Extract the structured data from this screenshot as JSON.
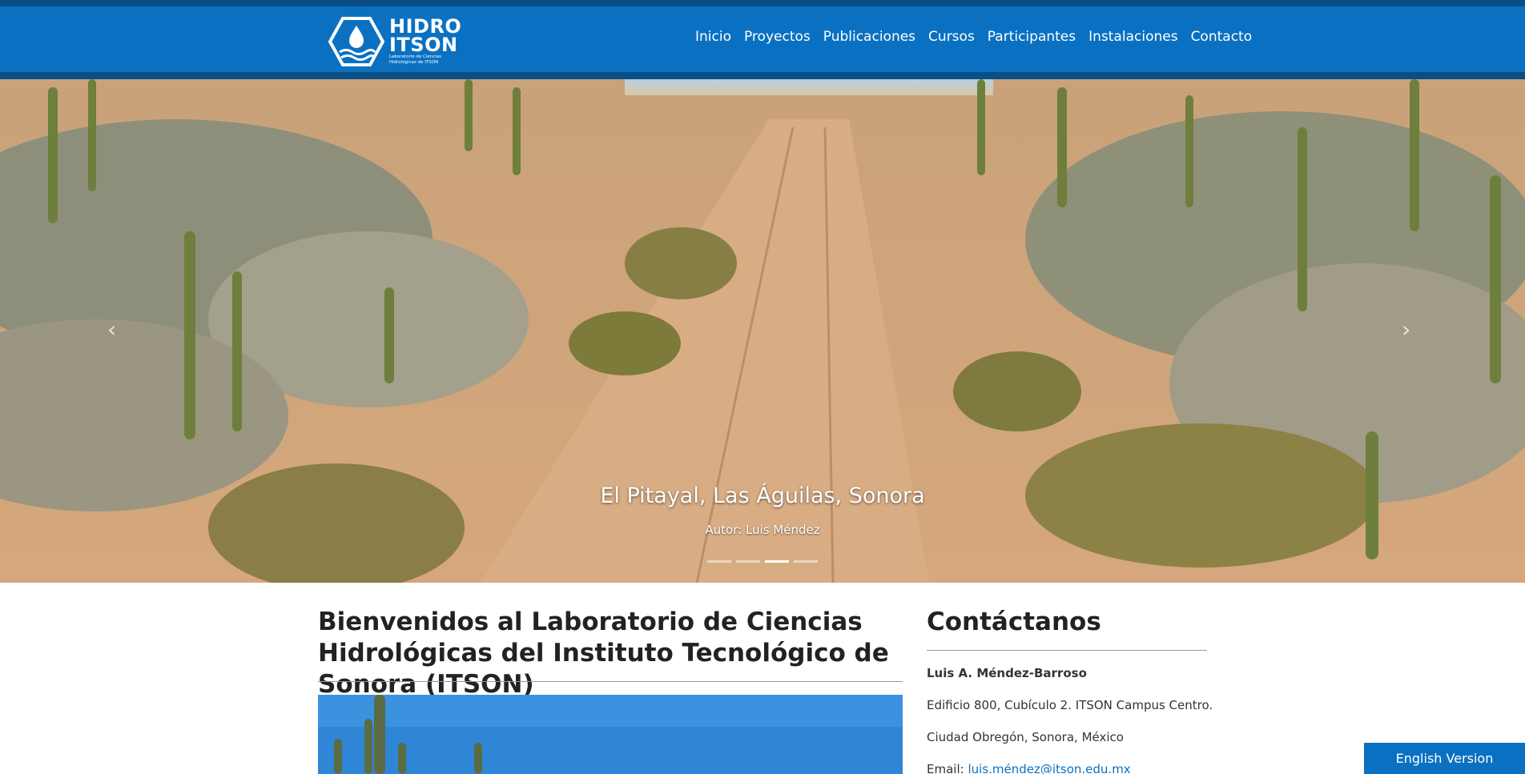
{
  "brand": {
    "logo_line1": "HIDRO",
    "logo_line2": "ITSON",
    "logo_sub1": "Laboratorio de Ciencias",
    "logo_sub2": "Hidrológicas de ITSON"
  },
  "nav": {
    "items": [
      "Inicio",
      "Proyectos",
      "Publicaciones",
      "Cursos",
      "Participantes",
      "Instalaciones",
      "Contacto"
    ]
  },
  "carousel": {
    "caption": "El Pitayal, Las Águilas, Sonora",
    "author": "Autor: Luis Méndez",
    "prev_icon": "chevron-left-icon",
    "next_icon": "chevron-right-icon",
    "prev_glyph": "‹",
    "next_glyph": "›",
    "slide_count": 4,
    "active_slide": 3
  },
  "main": {
    "welcome_title": "Bienvenidos al Laboratorio de Ciencias Hidrológicas del Instituto Tecnológico de Sonora (ITSON)"
  },
  "contact": {
    "title": "Contáctanos",
    "name": "Luis A. Méndez-Barroso",
    "address1": "Edificio 800, Cubículo 2. ITSON Campus Centro.",
    "address2": "Ciudad Obregón, Sonora, México",
    "email_label": "Email: ",
    "email": "luis.méndez@itson.edu.mx"
  },
  "language_button": "English Version",
  "colors": {
    "header_blue": "#0a71c2",
    "header_dark": "#0a4e86",
    "link_blue": "#0a71c2"
  }
}
